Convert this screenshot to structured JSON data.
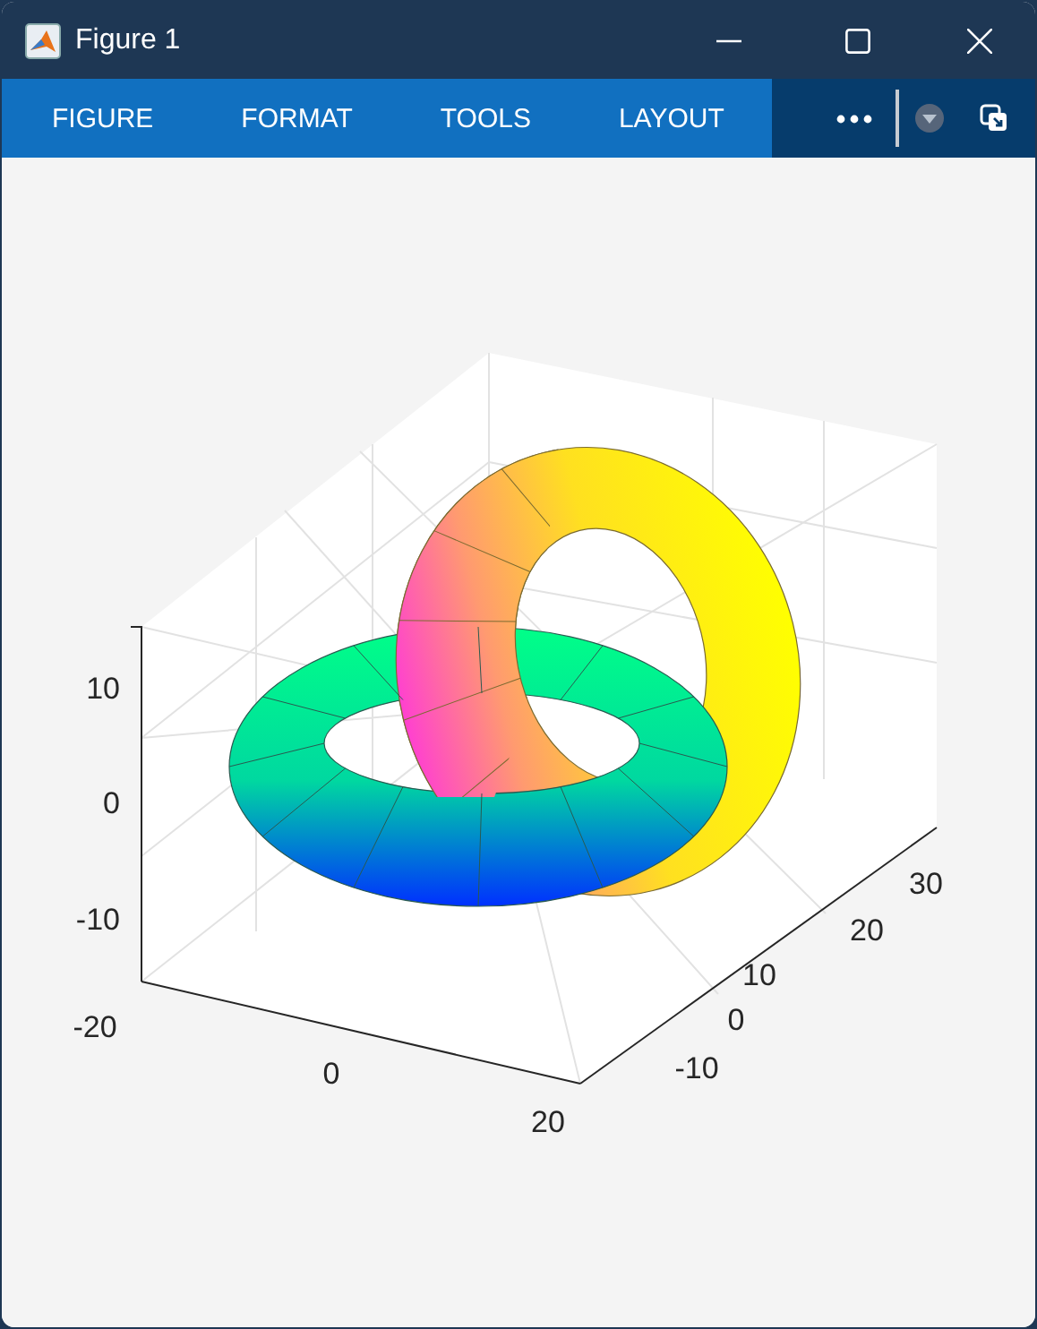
{
  "window": {
    "title": "Figure 1"
  },
  "toolstrip": {
    "tabs": [
      {
        "label": "FIGURE"
      },
      {
        "label": "FORMAT"
      },
      {
        "label": "TOOLS"
      },
      {
        "label": "LAYOUT"
      }
    ]
  },
  "axes": {
    "z_ticks": [
      "10",
      "0",
      "-10"
    ],
    "x_ticks": [
      "-20",
      "0",
      "20"
    ],
    "y_ticks": [
      "-10",
      "0",
      "10",
      "20",
      "30"
    ]
  }
}
